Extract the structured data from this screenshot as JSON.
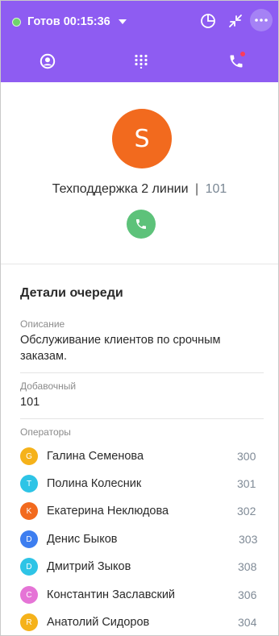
{
  "header": {
    "status_label": "Готов",
    "timer": "00:15:36",
    "status_color": "#6fd46b",
    "background": "#8e5cf2",
    "icons": [
      "pie-chart-icon",
      "collapse-icon",
      "more-icon"
    ]
  },
  "nav": {
    "items": [
      "profile-icon",
      "dialpad-icon",
      "phone-missed-icon"
    ],
    "has_badge": true
  },
  "queue": {
    "avatar_letter": "S",
    "avatar_color": "#f26a1e",
    "name": "Техподдержка 2 линии",
    "separator": "|",
    "number": "101",
    "call_color": "#5dc27a"
  },
  "details": {
    "title": "Детали очереди",
    "description_label": "Описание",
    "description_value": "Обслуживание клиентов по срочным заказам.",
    "extension_label": "Добавочный",
    "extension_value": "101",
    "operators_label": "Операторы"
  },
  "operators": [
    {
      "initial": "G",
      "name": "Галина Семенова",
      "ext": "300",
      "color": "#f5b21a"
    },
    {
      "initial": "T",
      "name": "Полина Колесник",
      "ext": "301",
      "color": "#2ec4e6"
    },
    {
      "initial": "K",
      "name": "Екатерина Неклюдова",
      "ext": "302",
      "color": "#f26a1e"
    },
    {
      "initial": "D",
      "name": "Денис Быков",
      "ext": "303",
      "color": "#3d7ef0"
    },
    {
      "initial": "D",
      "name": "Дмитрий Зыков",
      "ext": "308",
      "color": "#2ec4e6"
    },
    {
      "initial": "C",
      "name": "Константин Заславский",
      "ext": "306",
      "color": "#e574d6"
    },
    {
      "initial": "R",
      "name": "Анатолий Сидоров",
      "ext": "304",
      "color": "#f5b21a"
    }
  ]
}
